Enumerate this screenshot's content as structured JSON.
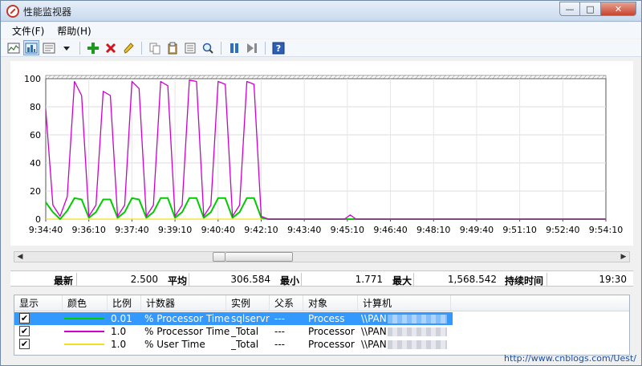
{
  "window": {
    "title": "性能监视器",
    "minimize_glyph": "—",
    "maximize_glyph": "□",
    "close_glyph": "✕"
  },
  "menu": [
    "文件(F)",
    "帮助(H)"
  ],
  "toolbar": {
    "icons": [
      "view-graph-icon",
      "view-histogram-icon",
      "view-report-icon",
      "dropdown-icon",
      "add-counter-icon",
      "delete-counter-icon",
      "highlight-icon",
      "copy-icon",
      "paste-icon",
      "properties-icon",
      "zoom-icon",
      "freeze-icon",
      "update-icon",
      "help-icon"
    ]
  },
  "chart_data": {
    "type": "line",
    "ylim": [
      0,
      100
    ],
    "yticks": [
      "100",
      "80",
      "60",
      "40",
      "20",
      "0"
    ],
    "xticks": [
      "9:34:40",
      "9:36:10",
      "9:37:40",
      "9:39:10",
      "9:40:40",
      "9:42:10",
      "9:43:40",
      "9:45:10",
      "9:46:40",
      "9:48:10",
      "9:49:40",
      "9:51:10",
      "9:52:40",
      "9:54:10"
    ],
    "x_range": [
      "9:34:40",
      "9:54:10"
    ],
    "grid": true,
    "series": [
      {
        "color": "#cc00cc",
        "points": [
          [
            0,
            78
          ],
          [
            5,
            10
          ],
          [
            10,
            2
          ],
          [
            15,
            16
          ],
          [
            20,
            98
          ],
          [
            25,
            88
          ],
          [
            30,
            2
          ],
          [
            35,
            10
          ],
          [
            40,
            91
          ],
          [
            45,
            88
          ],
          [
            50,
            2
          ],
          [
            55,
            10
          ],
          [
            60,
            98
          ],
          [
            65,
            93
          ],
          [
            70,
            2
          ],
          [
            75,
            10
          ],
          [
            80,
            98
          ],
          [
            85,
            95
          ],
          [
            90,
            2
          ],
          [
            95,
            10
          ],
          [
            100,
            99
          ],
          [
            105,
            98
          ],
          [
            110,
            2
          ],
          [
            115,
            10
          ],
          [
            120,
            98
          ],
          [
            125,
            96
          ],
          [
            130,
            2
          ],
          [
            135,
            10
          ],
          [
            140,
            98
          ],
          [
            145,
            96
          ],
          [
            150,
            2
          ],
          [
            155,
            0
          ],
          [
            160,
            0
          ],
          [
            195,
            0
          ],
          [
            200,
            0
          ],
          [
            208,
            0
          ],
          [
            212,
            3
          ],
          [
            216,
            0
          ],
          [
            390,
            0
          ]
        ]
      },
      {
        "color": "#00cc00",
        "points": [
          [
            0,
            12
          ],
          [
            5,
            5
          ],
          [
            10,
            0
          ],
          [
            15,
            6
          ],
          [
            20,
            15
          ],
          [
            25,
            14
          ],
          [
            30,
            1
          ],
          [
            35,
            5
          ],
          [
            40,
            14
          ],
          [
            45,
            14
          ],
          [
            50,
            1
          ],
          [
            55,
            5
          ],
          [
            60,
            15
          ],
          [
            65,
            14
          ],
          [
            70,
            1
          ],
          [
            75,
            5
          ],
          [
            80,
            15
          ],
          [
            85,
            15
          ],
          [
            90,
            1
          ],
          [
            95,
            5
          ],
          [
            100,
            15
          ],
          [
            105,
            15
          ],
          [
            110,
            1
          ],
          [
            115,
            5
          ],
          [
            120,
            15
          ],
          [
            125,
            15
          ],
          [
            130,
            1
          ],
          [
            135,
            5
          ],
          [
            140,
            15
          ],
          [
            145,
            15
          ],
          [
            150,
            1
          ],
          [
            155,
            0
          ],
          [
            390,
            0
          ]
        ]
      },
      {
        "color": "#f0e020",
        "points": [
          [
            0,
            0
          ],
          [
            390,
            0
          ]
        ]
      }
    ]
  },
  "stats": {
    "latest_label": "最新",
    "latest_value": "2.500",
    "avg_label": "平均",
    "avg_value": "306.584",
    "min_label": "最小",
    "min_value": "1.771",
    "max_label": "最大",
    "max_value": "1,568.542",
    "duration_label": "持续时间",
    "duration_value": "19:30"
  },
  "table": {
    "headers": [
      "显示",
      "颜色",
      "比例",
      "计数器",
      "实例",
      "父系",
      "对象",
      "计算机"
    ],
    "rows": [
      {
        "check": "✔",
        "color": "#00cc00",
        "scale": "0.01",
        "counter": "% Processor Time",
        "instance": "sqlservr",
        "parent": "---",
        "object": "Process",
        "computer": "\\\\PAN"
      },
      {
        "check": "✔",
        "color": "#cc00cc",
        "scale": "1.0",
        "counter": "% Processor Time",
        "instance": "_Total",
        "parent": "---",
        "object": "Processor",
        "computer": "\\\\PAN"
      },
      {
        "check": "✔",
        "color": "#f0e020",
        "scale": "1.0",
        "counter": "% User Time",
        "instance": "_Total",
        "parent": "---",
        "object": "Processor",
        "computer": "\\\\PAN"
      }
    ]
  },
  "watermark": "http://www.cnblogs.com/Uest/"
}
